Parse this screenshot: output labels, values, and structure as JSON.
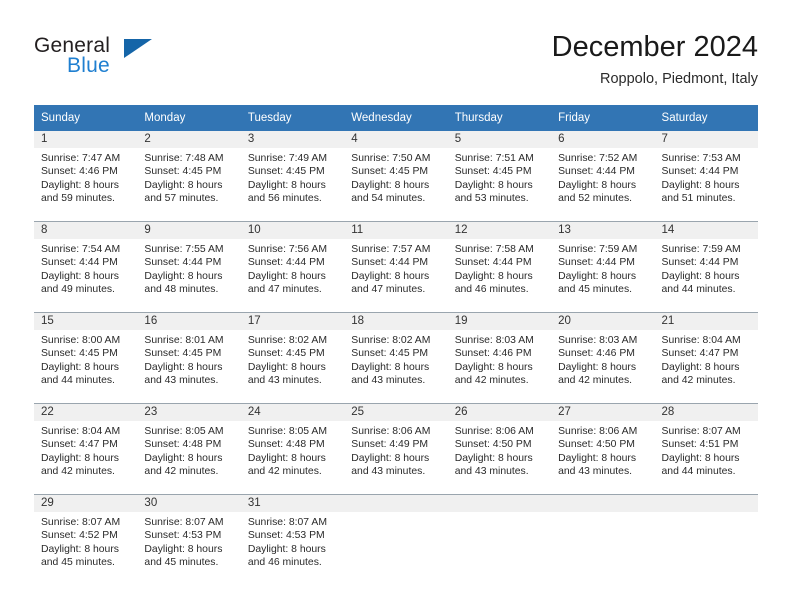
{
  "brand": {
    "name_top": "General",
    "name_bottom": "Blue",
    "triangle_color": "#1565a8",
    "blue_text_color": "#1f7fd0"
  },
  "header": {
    "month_title": "December 2024",
    "location": "Roppolo, Piedmont, Italy"
  },
  "theme": {
    "header_blue": "#3275b4",
    "daynum_band": "#f0f0f0",
    "row_divider": "#9aa5ae"
  },
  "calendar": {
    "weekday_headers": [
      "Sunday",
      "Monday",
      "Tuesday",
      "Wednesday",
      "Thursday",
      "Friday",
      "Saturday"
    ],
    "weeks": [
      [
        {
          "day": "1",
          "lines": [
            "Sunrise: 7:47 AM",
            "Sunset: 4:46 PM",
            "Daylight: 8 hours",
            "and 59 minutes."
          ]
        },
        {
          "day": "2",
          "lines": [
            "Sunrise: 7:48 AM",
            "Sunset: 4:45 PM",
            "Daylight: 8 hours",
            "and 57 minutes."
          ]
        },
        {
          "day": "3",
          "lines": [
            "Sunrise: 7:49 AM",
            "Sunset: 4:45 PM",
            "Daylight: 8 hours",
            "and 56 minutes."
          ]
        },
        {
          "day": "4",
          "lines": [
            "Sunrise: 7:50 AM",
            "Sunset: 4:45 PM",
            "Daylight: 8 hours",
            "and 54 minutes."
          ]
        },
        {
          "day": "5",
          "lines": [
            "Sunrise: 7:51 AM",
            "Sunset: 4:45 PM",
            "Daylight: 8 hours",
            "and 53 minutes."
          ]
        },
        {
          "day": "6",
          "lines": [
            "Sunrise: 7:52 AM",
            "Sunset: 4:44 PM",
            "Daylight: 8 hours",
            "and 52 minutes."
          ]
        },
        {
          "day": "7",
          "lines": [
            "Sunrise: 7:53 AM",
            "Sunset: 4:44 PM",
            "Daylight: 8 hours",
            "and 51 minutes."
          ]
        }
      ],
      [
        {
          "day": "8",
          "lines": [
            "Sunrise: 7:54 AM",
            "Sunset: 4:44 PM",
            "Daylight: 8 hours",
            "and 49 minutes."
          ]
        },
        {
          "day": "9",
          "lines": [
            "Sunrise: 7:55 AM",
            "Sunset: 4:44 PM",
            "Daylight: 8 hours",
            "and 48 minutes."
          ]
        },
        {
          "day": "10",
          "lines": [
            "Sunrise: 7:56 AM",
            "Sunset: 4:44 PM",
            "Daylight: 8 hours",
            "and 47 minutes."
          ]
        },
        {
          "day": "11",
          "lines": [
            "Sunrise: 7:57 AM",
            "Sunset: 4:44 PM",
            "Daylight: 8 hours",
            "and 47 minutes."
          ]
        },
        {
          "day": "12",
          "lines": [
            "Sunrise: 7:58 AM",
            "Sunset: 4:44 PM",
            "Daylight: 8 hours",
            "and 46 minutes."
          ]
        },
        {
          "day": "13",
          "lines": [
            "Sunrise: 7:59 AM",
            "Sunset: 4:44 PM",
            "Daylight: 8 hours",
            "and 45 minutes."
          ]
        },
        {
          "day": "14",
          "lines": [
            "Sunrise: 7:59 AM",
            "Sunset: 4:44 PM",
            "Daylight: 8 hours",
            "and 44 minutes."
          ]
        }
      ],
      [
        {
          "day": "15",
          "lines": [
            "Sunrise: 8:00 AM",
            "Sunset: 4:45 PM",
            "Daylight: 8 hours",
            "and 44 minutes."
          ]
        },
        {
          "day": "16",
          "lines": [
            "Sunrise: 8:01 AM",
            "Sunset: 4:45 PM",
            "Daylight: 8 hours",
            "and 43 minutes."
          ]
        },
        {
          "day": "17",
          "lines": [
            "Sunrise: 8:02 AM",
            "Sunset: 4:45 PM",
            "Daylight: 8 hours",
            "and 43 minutes."
          ]
        },
        {
          "day": "18",
          "lines": [
            "Sunrise: 8:02 AM",
            "Sunset: 4:45 PM",
            "Daylight: 8 hours",
            "and 43 minutes."
          ]
        },
        {
          "day": "19",
          "lines": [
            "Sunrise: 8:03 AM",
            "Sunset: 4:46 PM",
            "Daylight: 8 hours",
            "and 42 minutes."
          ]
        },
        {
          "day": "20",
          "lines": [
            "Sunrise: 8:03 AM",
            "Sunset: 4:46 PM",
            "Daylight: 8 hours",
            "and 42 minutes."
          ]
        },
        {
          "day": "21",
          "lines": [
            "Sunrise: 8:04 AM",
            "Sunset: 4:47 PM",
            "Daylight: 8 hours",
            "and 42 minutes."
          ]
        }
      ],
      [
        {
          "day": "22",
          "lines": [
            "Sunrise: 8:04 AM",
            "Sunset: 4:47 PM",
            "Daylight: 8 hours",
            "and 42 minutes."
          ]
        },
        {
          "day": "23",
          "lines": [
            "Sunrise: 8:05 AM",
            "Sunset: 4:48 PM",
            "Daylight: 8 hours",
            "and 42 minutes."
          ]
        },
        {
          "day": "24",
          "lines": [
            "Sunrise: 8:05 AM",
            "Sunset: 4:48 PM",
            "Daylight: 8 hours",
            "and 42 minutes."
          ]
        },
        {
          "day": "25",
          "lines": [
            "Sunrise: 8:06 AM",
            "Sunset: 4:49 PM",
            "Daylight: 8 hours",
            "and 43 minutes."
          ]
        },
        {
          "day": "26",
          "lines": [
            "Sunrise: 8:06 AM",
            "Sunset: 4:50 PM",
            "Daylight: 8 hours",
            "and 43 minutes."
          ]
        },
        {
          "day": "27",
          "lines": [
            "Sunrise: 8:06 AM",
            "Sunset: 4:50 PM",
            "Daylight: 8 hours",
            "and 43 minutes."
          ]
        },
        {
          "day": "28",
          "lines": [
            "Sunrise: 8:07 AM",
            "Sunset: 4:51 PM",
            "Daylight: 8 hours",
            "and 44 minutes."
          ]
        }
      ],
      [
        {
          "day": "29",
          "lines": [
            "Sunrise: 8:07 AM",
            "Sunset: 4:52 PM",
            "Daylight: 8 hours",
            "and 45 minutes."
          ]
        },
        {
          "day": "30",
          "lines": [
            "Sunrise: 8:07 AM",
            "Sunset: 4:53 PM",
            "Daylight: 8 hours",
            "and 45 minutes."
          ]
        },
        {
          "day": "31",
          "lines": [
            "Sunrise: 8:07 AM",
            "Sunset: 4:53 PM",
            "Daylight: 8 hours",
            "and 46 minutes."
          ]
        },
        {
          "day": "",
          "lines": []
        },
        {
          "day": "",
          "lines": []
        },
        {
          "day": "",
          "lines": []
        },
        {
          "day": "",
          "lines": []
        }
      ]
    ]
  }
}
